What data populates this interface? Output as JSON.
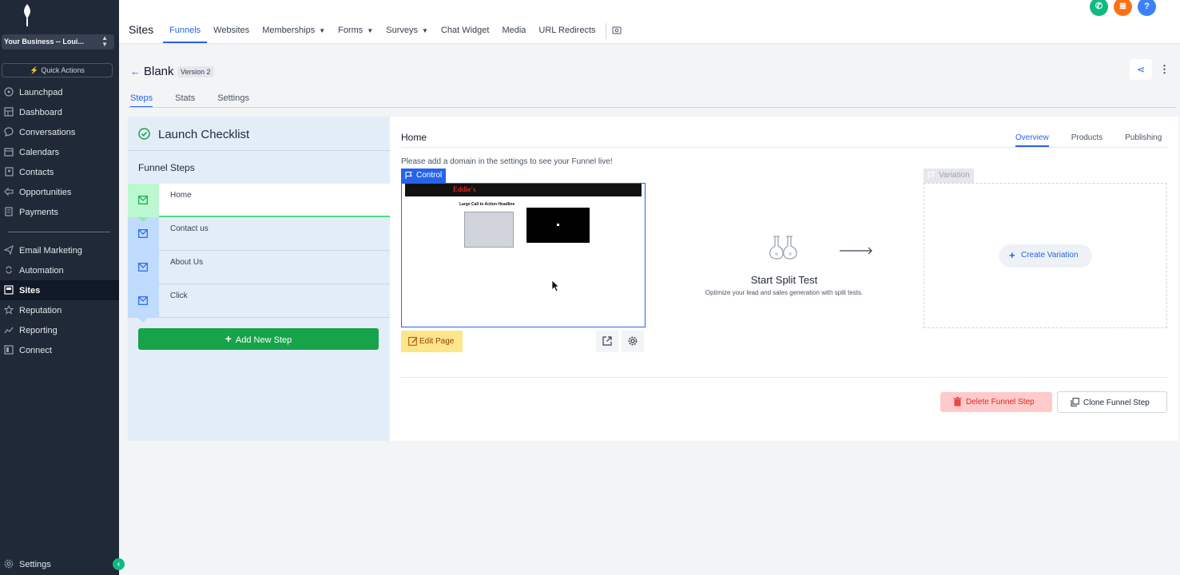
{
  "sidebar": {
    "business": "Your Business -- Loui...",
    "quick_actions": "Quick Actions",
    "items": [
      {
        "label": "Launchpad",
        "icon": "rocket-icon"
      },
      {
        "label": "Dashboard",
        "icon": "dashboard-icon"
      },
      {
        "label": "Conversations",
        "icon": "chat-icon"
      },
      {
        "label": "Calendars",
        "icon": "calendar-icon"
      },
      {
        "label": "Contacts",
        "icon": "contacts-icon"
      },
      {
        "label": "Opportunities",
        "icon": "funnel-icon"
      },
      {
        "label": "Payments",
        "icon": "payments-icon"
      }
    ],
    "items2": [
      {
        "label": "Email Marketing",
        "icon": "send-icon"
      },
      {
        "label": "Automation",
        "icon": "automation-icon"
      },
      {
        "label": "Sites",
        "icon": "sites-icon",
        "active": true
      },
      {
        "label": "Reputation",
        "icon": "star-icon"
      },
      {
        "label": "Reporting",
        "icon": "chart-icon"
      },
      {
        "label": "Connect",
        "icon": "connect-icon"
      }
    ],
    "settings": "Settings"
  },
  "topbar": {
    "title": "Sites",
    "tabs": [
      {
        "label": "Funnels",
        "active": true
      },
      {
        "label": "Websites"
      },
      {
        "label": "Memberships",
        "dropdown": true
      },
      {
        "label": "Forms",
        "dropdown": true
      },
      {
        "label": "Surveys",
        "dropdown": true
      },
      {
        "label": "Chat Widget"
      },
      {
        "label": "Media"
      },
      {
        "label": "URL Redirects"
      }
    ]
  },
  "funnel": {
    "name": "Blank",
    "version": "Version 2",
    "subtabs": [
      "Steps",
      "Stats",
      "Settings"
    ]
  },
  "checklist": {
    "title": "Launch Checklist",
    "steps_title": "Funnel Steps",
    "steps": [
      "Home",
      "Contact us",
      "About Us",
      "Click"
    ],
    "add_step": "Add New Step"
  },
  "main": {
    "page_title": "Home",
    "tabs": [
      "Overview",
      "Products",
      "Publishing"
    ],
    "domain_note": "Please add a domain in the settings to see your Funnel live!",
    "control": "Control",
    "preview_headline": "Large Call to Action Headline",
    "edit_page": "Edit Page",
    "split_title": "Start Split Test",
    "split_sub": "Optimize your lead and sales generation with split tests.",
    "variation": "Variation",
    "create_variation": "Create Variation",
    "delete_step": "Delete Funnel Step",
    "clone_step": "Clone Funnel Step"
  },
  "colors": {
    "accent": "#2563eb",
    "success": "#16a34a",
    "danger": "#dc2626",
    "sidebar": "#1f2937"
  }
}
